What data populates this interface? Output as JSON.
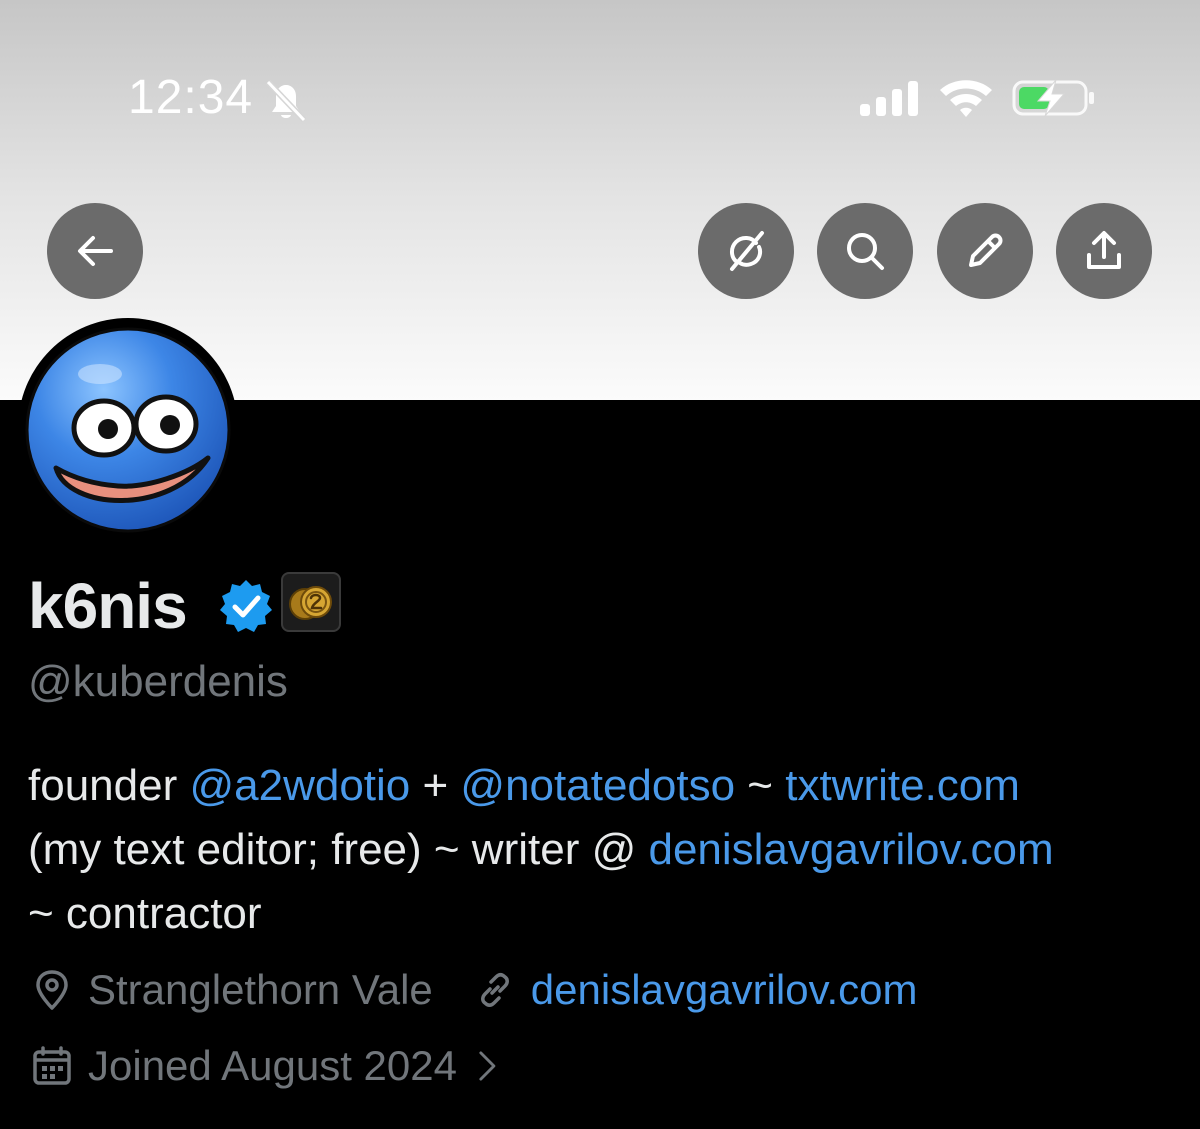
{
  "status_bar": {
    "time": "12:34"
  },
  "toolbar": {
    "buttons": [
      "back-arrow-icon",
      "grok-icon",
      "search-icon",
      "edit-pencil-icon",
      "share-icon"
    ]
  },
  "profile": {
    "display_name": "k6nis",
    "handle": "@kuberdenis",
    "bio": {
      "line1": [
        {
          "text": "founder ",
          "link": false
        },
        {
          "text": "@a2wdotio",
          "link": true
        },
        {
          "text": " + ",
          "link": false
        },
        {
          "text": "@notatedotso",
          "link": true
        },
        {
          "text": " ~ ",
          "link": false
        },
        {
          "text": "txtwrite.com",
          "link": true
        }
      ],
      "line2": [
        {
          "text": "(my text editor; free) ~ writer @ ",
          "link": false
        },
        {
          "text": "denislavgavrilov.com",
          "link": true
        }
      ],
      "line3": [
        {
          "text": "~ contractor",
          "link": false
        }
      ]
    },
    "location": "Stranglethorn Vale",
    "website": "denislavgavrilov.com",
    "joined": "Joined August 2024"
  },
  "colors": {
    "link": "#4a99e9",
    "muted": "#71767b",
    "text": "#e7e9ea",
    "verified": "#1d9bf0",
    "button_bg": "#6b6b6b"
  }
}
